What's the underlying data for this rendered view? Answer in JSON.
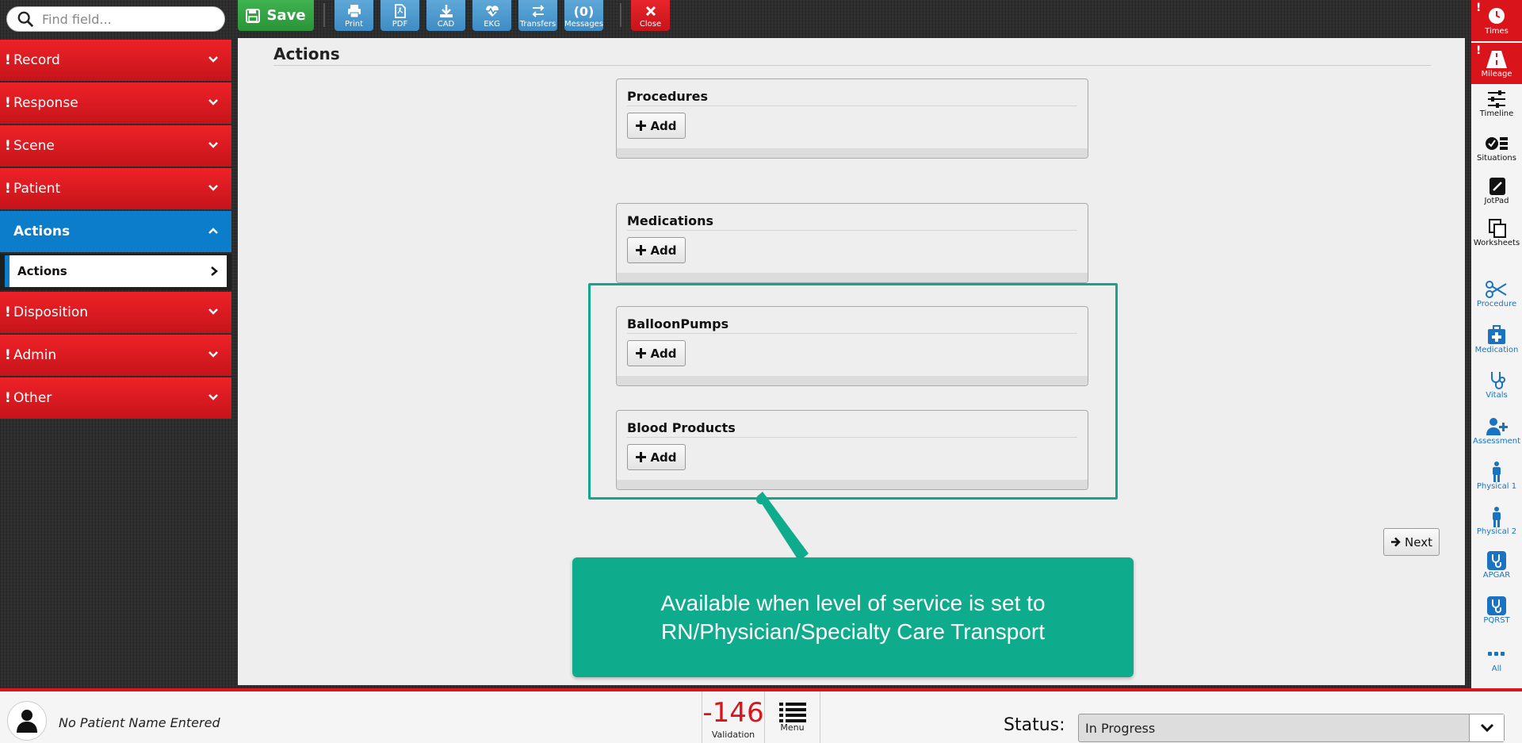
{
  "search": {
    "placeholder": "Find field..."
  },
  "sidebar": {
    "items": [
      {
        "label": "Record",
        "required": "!"
      },
      {
        "label": "Response",
        "required": "!"
      },
      {
        "label": "Scene",
        "required": "!"
      },
      {
        "label": "Patient",
        "required": "!"
      },
      {
        "label": "Actions",
        "required": ""
      },
      {
        "label": "Disposition",
        "required": "!"
      },
      {
        "label": "Admin",
        "required": "!"
      },
      {
        "label": "Other",
        "required": "!"
      }
    ],
    "sub_item": "Actions"
  },
  "toolbar": {
    "save_label": "Save",
    "print": "Print",
    "pdf": "PDF",
    "cad": "CAD",
    "ekg": "EKG",
    "transfers": "Transfers",
    "messages_count": "(0)",
    "messages": "Messages",
    "close": "Close"
  },
  "main": {
    "title": "Actions",
    "sections": [
      {
        "title": "Procedures",
        "add_label": "Add"
      },
      {
        "title": "Medications",
        "add_label": "Add"
      },
      {
        "title": "BalloonPumps",
        "add_label": "Add"
      },
      {
        "title": "Blood Products",
        "add_label": "Add"
      }
    ],
    "next_label": "Next"
  },
  "callout": {
    "line1": "Available when level of service is set to",
    "line2": "RN/Physician/Specialty Care Transport"
  },
  "right_bar": {
    "times": "Times",
    "mileage": "Mileage",
    "timeline": "Timeline",
    "situations": "Situations",
    "jotpad": "JotPad",
    "worksheets": "Worksheets",
    "procedure": "Procedure",
    "medication": "Medication",
    "vitals": "Vitals",
    "assessment": "Assessment",
    "physical1": "Physical 1",
    "physical2": "Physical 2",
    "apgar": "APGAR",
    "pqrst": "PQRST",
    "all": "All"
  },
  "bottom": {
    "patient_name": "No Patient Name Entered",
    "validation_count": "-146",
    "validation_label": "Validation",
    "menu_label": "Menu",
    "status_label": "Status:",
    "status_value": "In Progress"
  },
  "colors": {
    "accent_red": "#d9141b",
    "accent_blue": "#0b7dcb",
    "save_green": "#2a9437",
    "callout_teal": "#0fab8d"
  }
}
